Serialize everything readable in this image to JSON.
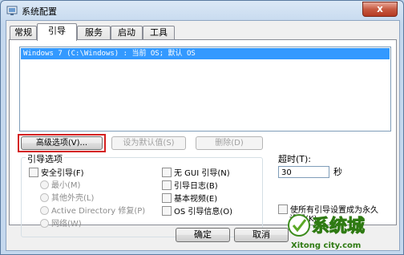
{
  "window": {
    "title": "系统配置",
    "close_symbol": "x"
  },
  "tabs": [
    {
      "label": "常规",
      "active": false
    },
    {
      "label": "引导",
      "active": true
    },
    {
      "label": "服务",
      "active": false
    },
    {
      "label": "启动",
      "active": false
    },
    {
      "label": "工具",
      "active": false
    }
  ],
  "boot_list": {
    "entries": [
      "Windows 7 (C:\\Windows) : 当前 OS; 默认 OS"
    ]
  },
  "buttons": {
    "advanced": "高级选项(V)...",
    "set_default": "设为默认值(S)",
    "delete": "删除(D)"
  },
  "boot_options": {
    "title": "引导选项",
    "safe_boot": "安全引导(F)",
    "minimal": "最小(M)",
    "alternate_shell": "其他外壳(L)",
    "active_directory": "Active Directory 修复(P)",
    "network": "网络(W)",
    "no_gui": "无 GUI 引导(N)",
    "boot_log": "引导日志(B)",
    "base_video": "基本视频(E)",
    "os_info": "OS 引导信息(O)"
  },
  "timeout": {
    "label": "超时(T):",
    "value": "30",
    "unit": "秒"
  },
  "permanent": {
    "label_line1": "使所有引导设置成为永久",
    "label_line2": "设置(K)"
  },
  "footer": {
    "ok": "确定",
    "cancel": "取消"
  },
  "watermark": {
    "brand": "系统城",
    "domain": "Xitong city.com"
  },
  "colors": {
    "selection": "#3399ff",
    "highlight_box": "#d42020",
    "close_button": "#c75a41"
  }
}
